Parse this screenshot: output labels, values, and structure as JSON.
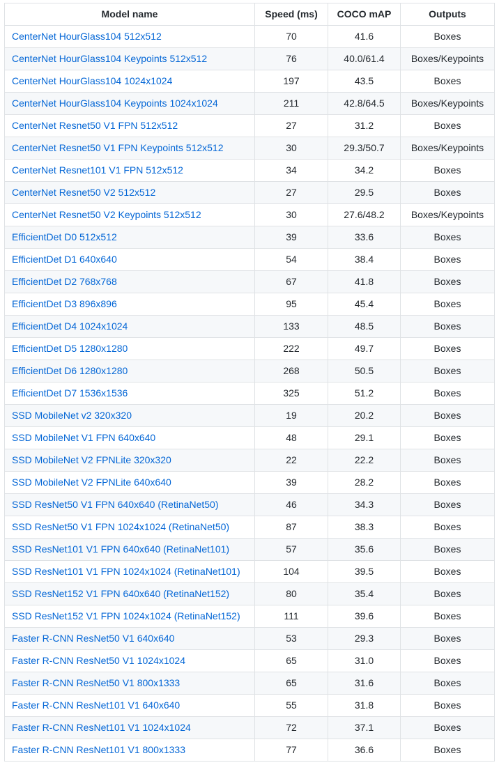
{
  "table": {
    "headers": {
      "name": "Model name",
      "speed": "Speed (ms)",
      "map": "COCO mAP",
      "outputs": "Outputs"
    },
    "rows": [
      {
        "name": "CenterNet HourGlass104 512x512",
        "speed": "70",
        "map": "41.6",
        "outputs": "Boxes"
      },
      {
        "name": "CenterNet HourGlass104 Keypoints 512x512",
        "speed": "76",
        "map": "40.0/61.4",
        "outputs": "Boxes/Keypoints"
      },
      {
        "name": "CenterNet HourGlass104 1024x1024",
        "speed": "197",
        "map": "43.5",
        "outputs": "Boxes"
      },
      {
        "name": "CenterNet HourGlass104 Keypoints 1024x1024",
        "speed": "211",
        "map": "42.8/64.5",
        "outputs": "Boxes/Keypoints"
      },
      {
        "name": "CenterNet Resnet50 V1 FPN 512x512",
        "speed": "27",
        "map": "31.2",
        "outputs": "Boxes"
      },
      {
        "name": "CenterNet Resnet50 V1 FPN Keypoints 512x512",
        "speed": "30",
        "map": "29.3/50.7",
        "outputs": "Boxes/Keypoints"
      },
      {
        "name": "CenterNet Resnet101 V1 FPN 512x512",
        "speed": "34",
        "map": "34.2",
        "outputs": "Boxes"
      },
      {
        "name": "CenterNet Resnet50 V2 512x512",
        "speed": "27",
        "map": "29.5",
        "outputs": "Boxes"
      },
      {
        "name": "CenterNet Resnet50 V2 Keypoints 512x512",
        "speed": "30",
        "map": "27.6/48.2",
        "outputs": "Boxes/Keypoints"
      },
      {
        "name": "EfficientDet D0 512x512",
        "speed": "39",
        "map": "33.6",
        "outputs": "Boxes"
      },
      {
        "name": "EfficientDet D1 640x640",
        "speed": "54",
        "map": "38.4",
        "outputs": "Boxes"
      },
      {
        "name": "EfficientDet D2 768x768",
        "speed": "67",
        "map": "41.8",
        "outputs": "Boxes"
      },
      {
        "name": "EfficientDet D3 896x896",
        "speed": "95",
        "map": "45.4",
        "outputs": "Boxes"
      },
      {
        "name": "EfficientDet D4 1024x1024",
        "speed": "133",
        "map": "48.5",
        "outputs": "Boxes"
      },
      {
        "name": "EfficientDet D5 1280x1280",
        "speed": "222",
        "map": "49.7",
        "outputs": "Boxes"
      },
      {
        "name": "EfficientDet D6 1280x1280",
        "speed": "268",
        "map": "50.5",
        "outputs": "Boxes"
      },
      {
        "name": "EfficientDet D7 1536x1536",
        "speed": "325",
        "map": "51.2",
        "outputs": "Boxes"
      },
      {
        "name": "SSD MobileNet v2 320x320",
        "speed": "19",
        "map": "20.2",
        "outputs": "Boxes"
      },
      {
        "name": "SSD MobileNet V1 FPN 640x640",
        "speed": "48",
        "map": "29.1",
        "outputs": "Boxes"
      },
      {
        "name": "SSD MobileNet V2 FPNLite 320x320",
        "speed": "22",
        "map": "22.2",
        "outputs": "Boxes"
      },
      {
        "name": "SSD MobileNet V2 FPNLite 640x640",
        "speed": "39",
        "map": "28.2",
        "outputs": "Boxes"
      },
      {
        "name": "SSD ResNet50 V1 FPN 640x640 (RetinaNet50)",
        "speed": "46",
        "map": "34.3",
        "outputs": "Boxes"
      },
      {
        "name": "SSD ResNet50 V1 FPN 1024x1024 (RetinaNet50)",
        "speed": "87",
        "map": "38.3",
        "outputs": "Boxes"
      },
      {
        "name": "SSD ResNet101 V1 FPN 640x640 (RetinaNet101)",
        "speed": "57",
        "map": "35.6",
        "outputs": "Boxes"
      },
      {
        "name": "SSD ResNet101 V1 FPN 1024x1024 (RetinaNet101)",
        "speed": "104",
        "map": "39.5",
        "outputs": "Boxes"
      },
      {
        "name": "SSD ResNet152 V1 FPN 640x640 (RetinaNet152)",
        "speed": "80",
        "map": "35.4",
        "outputs": "Boxes"
      },
      {
        "name": "SSD ResNet152 V1 FPN 1024x1024 (RetinaNet152)",
        "speed": "111",
        "map": "39.6",
        "outputs": "Boxes"
      },
      {
        "name": "Faster R-CNN ResNet50 V1 640x640",
        "speed": "53",
        "map": "29.3",
        "outputs": "Boxes"
      },
      {
        "name": "Faster R-CNN ResNet50 V1 1024x1024",
        "speed": "65",
        "map": "31.0",
        "outputs": "Boxes"
      },
      {
        "name": "Faster R-CNN ResNet50 V1 800x1333",
        "speed": "65",
        "map": "31.6",
        "outputs": "Boxes"
      },
      {
        "name": "Faster R-CNN ResNet101 V1 640x640",
        "speed": "55",
        "map": "31.8",
        "outputs": "Boxes"
      },
      {
        "name": "Faster R-CNN ResNet101 V1 1024x1024",
        "speed": "72",
        "map": "37.1",
        "outputs": "Boxes"
      },
      {
        "name": "Faster R-CNN ResNet101 V1 800x1333",
        "speed": "77",
        "map": "36.6",
        "outputs": "Boxes"
      }
    ]
  },
  "colors": {
    "link": "#0366d6",
    "border": "#dfe2e5",
    "stripe": "#f6f8fa"
  }
}
